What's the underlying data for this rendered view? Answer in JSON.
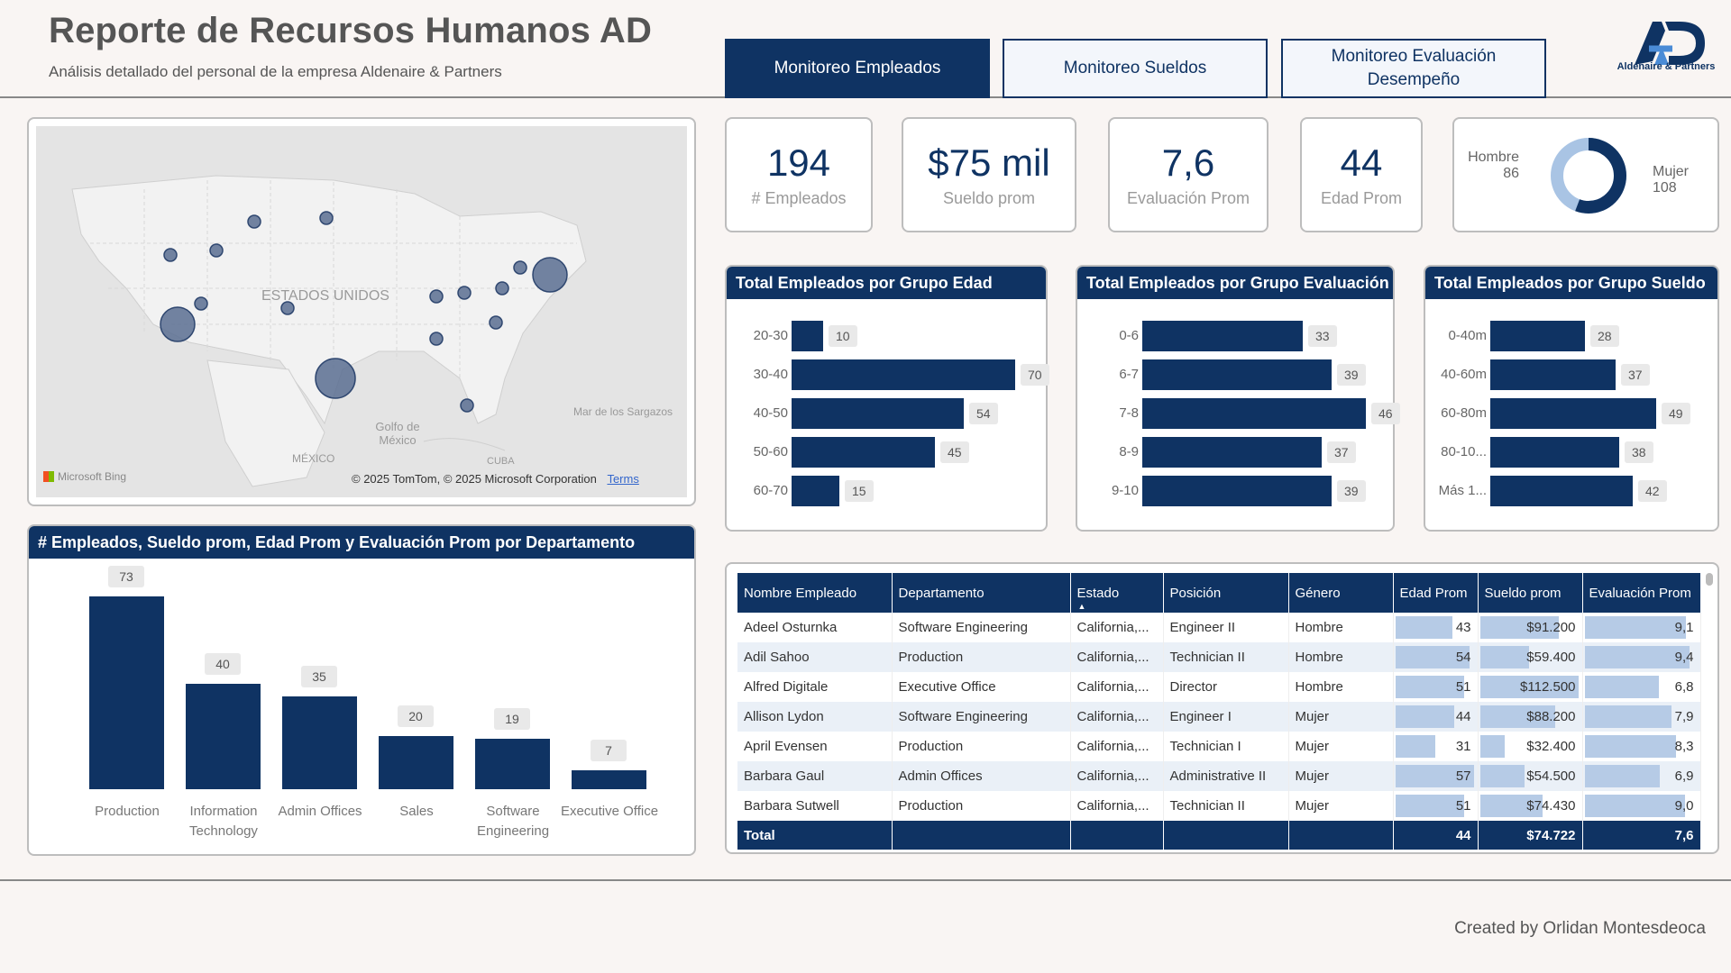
{
  "header": {
    "title": "Reporte de Recursos Humanos AD",
    "subtitle": "Análisis detallado del personal de la empresa Aldenaire & Partners",
    "logo_text": "Aldenaire & Partners"
  },
  "tabs": [
    {
      "label": "Monitoreo Empleados",
      "active": true
    },
    {
      "label": "Monitoreo Sueldos",
      "active": false
    },
    {
      "label": "Monitoreo Evaluación Desempeño",
      "active": false
    }
  ],
  "kpis": [
    {
      "value": "194",
      "label": "# Empleados"
    },
    {
      "value": "$75 mil",
      "label": "Sueldo prom"
    },
    {
      "value": "7,6",
      "label": "Evaluación Prom"
    },
    {
      "value": "44",
      "label": "Edad Prom"
    }
  ],
  "gender": {
    "male_label": "Hombre",
    "male": 86,
    "female_label": "Mujer",
    "female": 108
  },
  "map": {
    "country_label": "ESTADOS UNIDOS",
    "gulf_label": "Golfo de México",
    "mexico_label": "MÉXICO",
    "cuba_label": "CUBA",
    "sargasso_label": "Mar de los Sargazos",
    "bing_label": "Microsoft Bing",
    "copyright": "© 2025 TomTom, © 2025 Microsoft Corporation",
    "terms": "Terms"
  },
  "colors": {
    "navy": "#0f3363",
    "bar_light": "#b6cbe6"
  },
  "chart_data": [
    {
      "type": "bar",
      "title": "Total Empleados por Grupo Edad",
      "categories": [
        "20-30",
        "30-40",
        "40-50",
        "50-60",
        "60-70"
      ],
      "values": [
        10,
        70,
        54,
        45,
        15
      ],
      "orientation": "horizontal"
    },
    {
      "type": "bar",
      "title": "Total Empleados por Grupo Evaluación",
      "categories": [
        "0-6",
        "6-7",
        "7-8",
        "8-9",
        "9-10"
      ],
      "values": [
        33,
        39,
        46,
        37,
        39
      ],
      "orientation": "horizontal"
    },
    {
      "type": "bar",
      "title": "Total Empleados por Grupo Sueldo",
      "categories": [
        "0-40m",
        "40-60m",
        "60-80m",
        "80-10...",
        "Más 1..."
      ],
      "values": [
        28,
        37,
        49,
        38,
        42
      ],
      "orientation": "horizontal"
    },
    {
      "type": "bar",
      "title": "# Empleados, Sueldo prom, Edad Prom y Evaluación Prom por Departamento",
      "categories": [
        "Production",
        "Information Technology",
        "Admin Offices",
        "Sales",
        "Software Engineering",
        "Executive Office"
      ],
      "values": [
        73,
        40,
        35,
        20,
        19,
        7
      ],
      "orientation": "vertical"
    }
  ],
  "table": {
    "columns": [
      "Nombre Empleado",
      "Departamento",
      "Estado",
      "Posición",
      "Género",
      "Edad Prom",
      "Sueldo prom",
      "Evaluación Prom"
    ],
    "rows": [
      [
        "Adeel Osturnka",
        "Software Engineering",
        "California,...",
        "Engineer II",
        "Hombre",
        "43",
        "$91.200",
        "9,1"
      ],
      [
        "Adil Sahoo",
        "Production",
        "California,...",
        "Technician II",
        "Hombre",
        "54",
        "$59.400",
        "9,4"
      ],
      [
        "Alfred Digitale",
        "Executive Office",
        "California,...",
        "Director",
        "Hombre",
        "51",
        "$112.500",
        "6,8"
      ],
      [
        "Allison Lydon",
        "Software Engineering",
        "California,...",
        "Engineer I",
        "Mujer",
        "44",
        "$88.200",
        "7,9"
      ],
      [
        "April Evensen",
        "Production",
        "California,...",
        "Technician I",
        "Mujer",
        "31",
        "$32.400",
        "8,3"
      ],
      [
        "Barbara Gaul",
        "Admin Offices",
        "California,...",
        "Administrative II",
        "Mujer",
        "57",
        "$54.500",
        "6,9"
      ],
      [
        "Barbara Sutwell",
        "Production",
        "California,...",
        "Technician II",
        "Mujer",
        "51",
        "$74.430",
        "9,0"
      ]
    ],
    "bar_fractions": [
      [
        0.75,
        0.81,
        0.91
      ],
      [
        0.95,
        0.53,
        0.94
      ],
      [
        0.89,
        1.0,
        0.68
      ],
      [
        0.77,
        0.78,
        0.79
      ],
      [
        0.54,
        0.29,
        0.83
      ],
      [
        1.0,
        0.48,
        0.69
      ],
      [
        0.89,
        0.66,
        0.9
      ]
    ],
    "total": [
      "Total",
      "",
      "",
      "",
      "",
      "44",
      "$74.722",
      "7,6"
    ]
  },
  "footer": "Created by Orlidan Montesdeoca"
}
